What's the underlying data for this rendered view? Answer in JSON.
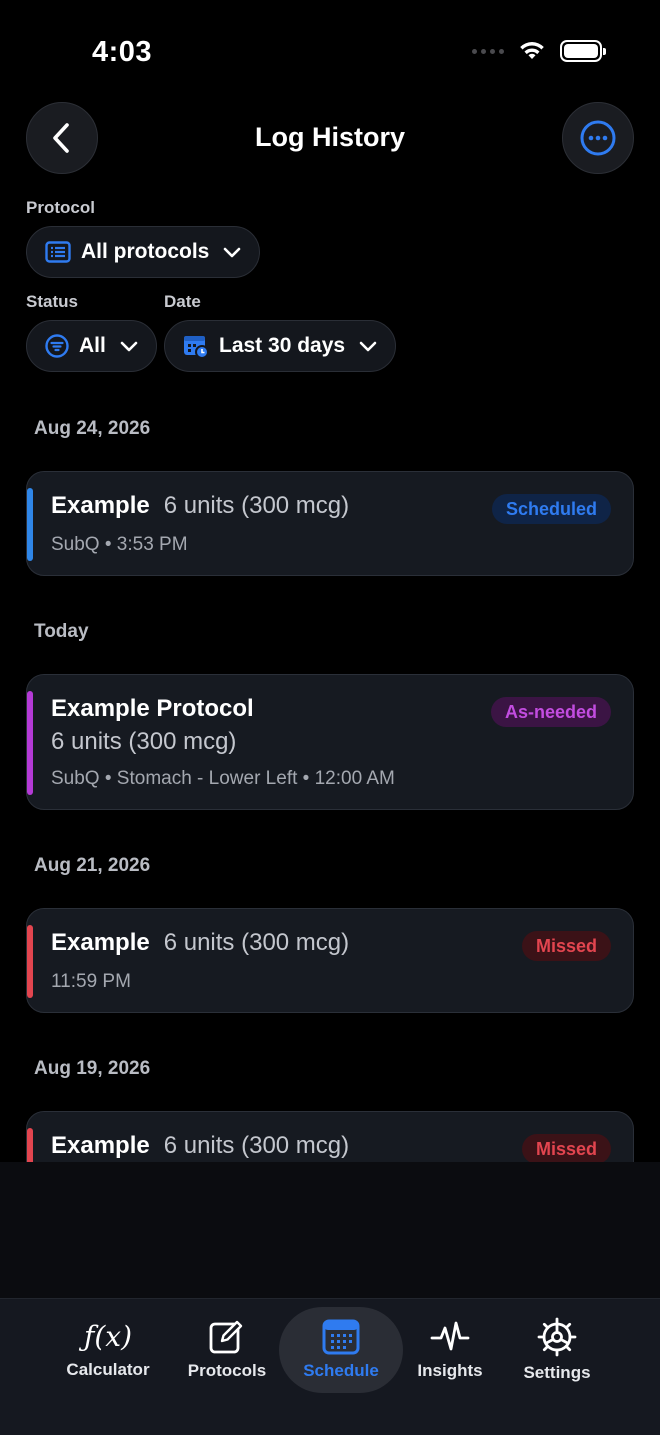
{
  "status_bar": {
    "time": "4:03"
  },
  "header": {
    "title": "Log History"
  },
  "filters": {
    "protocol_label": "Protocol",
    "protocol_value": "All protocols",
    "status_label": "Status",
    "status_value": "All",
    "date_label": "Date",
    "date_value": "Last 30 days"
  },
  "groups": [
    {
      "date": "Aug 24, 2026",
      "entries": [
        {
          "name": "Example",
          "dose": "6 units (300 mcg)",
          "details": "SubQ • 3:53 PM",
          "status": "Scheduled",
          "accent_color": "#2f86e8"
        }
      ]
    },
    {
      "date": "Today",
      "entries": [
        {
          "name": "Example Protocol",
          "dose": "6 units (300 mcg)",
          "details": "SubQ • Stomach - Lower Left • 12:00 AM",
          "status": "As-needed",
          "accent_color": "#b43ad6"
        }
      ]
    },
    {
      "date": "Aug 21, 2026",
      "entries": [
        {
          "name": "Example",
          "dose": "6 units (300 mcg)",
          "details": "11:59 PM",
          "status": "Missed",
          "accent_color": "#e2454f"
        }
      ]
    },
    {
      "date": "Aug 19, 2026",
      "entries": [
        {
          "name": "Example",
          "dose": "6 units (300 mcg)",
          "status": "Missed",
          "accent_color": "#e2454f"
        }
      ]
    }
  ],
  "tab_bar": {
    "tabs": [
      {
        "label": "Calculator",
        "icon": "fx-icon",
        "glyph": "ƒ(x)"
      },
      {
        "label": "Protocols",
        "icon": "edit-icon"
      },
      {
        "label": "Schedule",
        "icon": "calendar-icon",
        "active": true
      },
      {
        "label": "Insights",
        "icon": "pulse-icon"
      },
      {
        "label": "Settings",
        "icon": "gear-icon"
      }
    ]
  },
  "colors": {
    "accent": "#2f7bf0",
    "background": "#000000",
    "card": "#161a21"
  }
}
